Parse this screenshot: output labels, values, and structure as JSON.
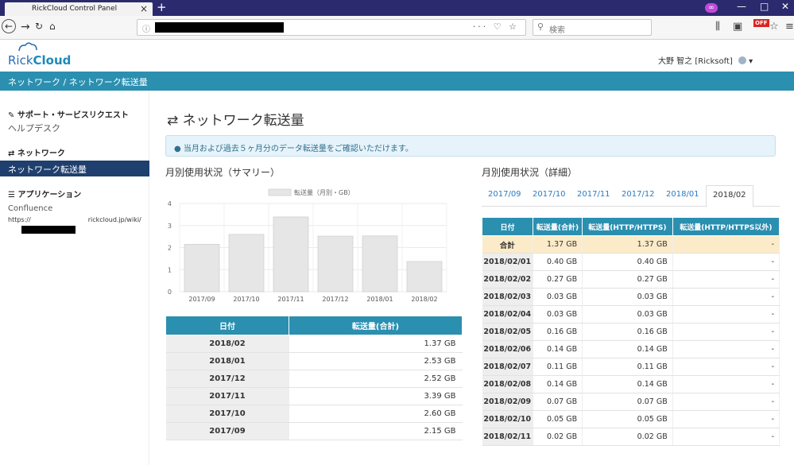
{
  "browser": {
    "tab_title": "RickCloud Control Panel",
    "tab_close": "×",
    "new_tab": "+",
    "private_badge": "∞",
    "search_placeholder": "検索",
    "off_badge": "OFF"
  },
  "app": {
    "logo_prefix": "Rick",
    "logo_bold": "Cloud",
    "user_name": "大野 智之 [Ricksoft]"
  },
  "breadcrumb": "ネットワーク / ネットワーク転送量",
  "sidebar": {
    "support_head": "サポート・サービスリクエスト",
    "helpdesk": "ヘルプデスク",
    "network_head": "ネットワーク",
    "network_transfer": "ネットワーク転送量",
    "apps_head": "アプリケーション",
    "confluence": "Confluence",
    "confluence_url_prefix": "https://",
    "confluence_url_suffix": "rickcloud.jp/wiki/"
  },
  "main": {
    "title": "ネットワーク転送量",
    "info": "当月および過去５ヶ月分のデータ転送量をご確認いただけます。",
    "summary_title": "月別使用状況（サマリー）",
    "detail_title": "月別使用状況（詳細）"
  },
  "chart_data": {
    "type": "bar",
    "legend": "転送量（月別・GB）",
    "categories": [
      "2017/09",
      "2017/10",
      "2017/11",
      "2017/12",
      "2018/01",
      "2018/02"
    ],
    "values": [
      2.15,
      2.6,
      3.39,
      2.52,
      2.53,
      1.37
    ],
    "ylim": [
      0,
      4
    ],
    "yticks": [
      "0",
      "1",
      "2",
      "3",
      "4"
    ],
    "bar_color": "#e6e6e6",
    "bar_border": "#cccccc"
  },
  "summary_table": {
    "headers": [
      "日付",
      "転送量(合計)"
    ],
    "rows": [
      [
        "2018/02",
        "1.37  GB"
      ],
      [
        "2018/01",
        "2.53  GB"
      ],
      [
        "2017/12",
        "2.52  GB"
      ],
      [
        "2017/11",
        "3.39  GB"
      ],
      [
        "2017/10",
        "2.60  GB"
      ],
      [
        "2017/09",
        "2.15  GB"
      ]
    ]
  },
  "month_tabs": [
    "2017/09",
    "2017/10",
    "2017/11",
    "2017/12",
    "2018/01",
    "2018/02"
  ],
  "detail_table": {
    "headers": [
      "日付",
      "転送量(合計)",
      "転送量(HTTP/HTTPS)",
      "転送量(HTTP/HTTPS以外)"
    ],
    "total": [
      "合計",
      "1.37 GB",
      "1.37 GB",
      "-"
    ],
    "rows": [
      [
        "2018/02/01",
        "0.40 GB",
        "0.40 GB",
        "-"
      ],
      [
        "2018/02/02",
        "0.27 GB",
        "0.27 GB",
        "-"
      ],
      [
        "2018/02/03",
        "0.03 GB",
        "0.03 GB",
        "-"
      ],
      [
        "2018/02/04",
        "0.03 GB",
        "0.03 GB",
        "-"
      ],
      [
        "2018/02/05",
        "0.16 GB",
        "0.16 GB",
        "-"
      ],
      [
        "2018/02/06",
        "0.14 GB",
        "0.14 GB",
        "-"
      ],
      [
        "2018/02/07",
        "0.11 GB",
        "0.11 GB",
        "-"
      ],
      [
        "2018/02/08",
        "0.14 GB",
        "0.14 GB",
        "-"
      ],
      [
        "2018/02/09",
        "0.07 GB",
        "0.07 GB",
        "-"
      ],
      [
        "2018/02/10",
        "0.05 GB",
        "0.05 GB",
        "-"
      ],
      [
        "2018/02/11",
        "0.02 GB",
        "0.02 GB",
        "-"
      ]
    ]
  }
}
